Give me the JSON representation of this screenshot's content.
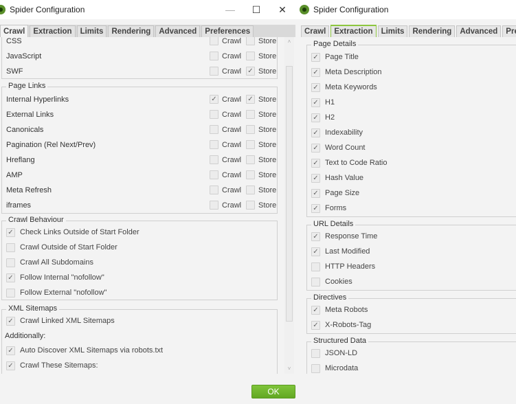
{
  "windows": {
    "left": {
      "title": "Spider Configuration",
      "controls": {
        "minimize": "—",
        "maximize": "☐",
        "close": "✕"
      },
      "tabs": [
        "Crawl",
        "Extraction",
        "Limits",
        "Rendering",
        "Advanced",
        "Preferences"
      ],
      "active_tab": "Crawl",
      "resources": {
        "rows": [
          {
            "label": "CSS",
            "crawl": false,
            "store": false
          },
          {
            "label": "JavaScript",
            "crawl": false,
            "store": false
          },
          {
            "label": "SWF",
            "crawl": false,
            "store": true
          }
        ]
      },
      "page_links": {
        "legend": "Page Links",
        "rows": [
          {
            "label": "Internal Hyperlinks",
            "crawl": true,
            "store": true
          },
          {
            "label": "External Links",
            "crawl": false,
            "store": false
          },
          {
            "label": "Canonicals",
            "crawl": false,
            "store": false
          },
          {
            "label": "Pagination (Rel Next/Prev)",
            "crawl": false,
            "store": false
          },
          {
            "label": "Hreflang",
            "crawl": false,
            "store": false
          },
          {
            "label": "AMP",
            "crawl": false,
            "store": false
          },
          {
            "label": "Meta Refresh",
            "crawl": false,
            "store": false
          },
          {
            "label": "iframes",
            "crawl": false,
            "store": false
          }
        ]
      },
      "crawl_label": "Crawl",
      "store_label": "Store",
      "crawl_behaviour": {
        "legend": "Crawl Behaviour",
        "items": [
          {
            "label": "Check Links Outside of Start Folder",
            "checked": true
          },
          {
            "label": "Crawl Outside of Start Folder",
            "checked": false
          },
          {
            "label": "Crawl All Subdomains",
            "checked": false
          },
          {
            "label": "Follow Internal \"nofollow\"",
            "checked": true
          },
          {
            "label": "Follow External \"nofollow\"",
            "checked": false
          }
        ]
      },
      "xml_sitemaps": {
        "legend": "XML Sitemaps",
        "crawl_linked": {
          "label": "Crawl Linked XML Sitemaps",
          "checked": true
        },
        "additionally_label": "Additionally:",
        "auto_discover": {
          "label": "Auto Discover XML Sitemaps via robots.txt",
          "checked": true
        },
        "crawl_these": {
          "label": "Crawl These Sitemaps:",
          "checked": true
        }
      },
      "scroll": {
        "up": "˄",
        "down": "˅"
      }
    },
    "right": {
      "title": "Spider Configuration",
      "tabs": [
        "Crawl",
        "Extraction",
        "Limits",
        "Rendering",
        "Advanced",
        "Preferences"
      ],
      "active_tab": "Extraction",
      "page_details": {
        "legend": "Page Details",
        "items": [
          {
            "label": "Page Title",
            "checked": true
          },
          {
            "label": "Meta Description",
            "checked": true
          },
          {
            "label": "Meta Keywords",
            "checked": true
          },
          {
            "label": "H1",
            "checked": true
          },
          {
            "label": "H2",
            "checked": true
          },
          {
            "label": "Indexability",
            "checked": true
          },
          {
            "label": "Word Count",
            "checked": true
          },
          {
            "label": "Text to Code Ratio",
            "checked": true
          },
          {
            "label": "Hash Value",
            "checked": true
          },
          {
            "label": "Page Size",
            "checked": true
          },
          {
            "label": "Forms",
            "checked": true
          }
        ]
      },
      "url_details": {
        "legend": "URL Details",
        "items": [
          {
            "label": "Response Time",
            "checked": true
          },
          {
            "label": "Last Modified",
            "checked": true
          },
          {
            "label": "HTTP Headers",
            "checked": false
          },
          {
            "label": "Cookies",
            "checked": false
          }
        ]
      },
      "directives": {
        "legend": "Directives",
        "items": [
          {
            "label": "Meta Robots",
            "checked": true
          },
          {
            "label": "X-Robots-Tag",
            "checked": true
          }
        ]
      },
      "structured_data": {
        "legend": "Structured Data",
        "items": [
          {
            "label": "JSON-LD",
            "checked": false
          },
          {
            "label": "Microdata",
            "checked": false
          }
        ]
      }
    }
  },
  "ok_button": "OK",
  "check_glyph": "✓"
}
